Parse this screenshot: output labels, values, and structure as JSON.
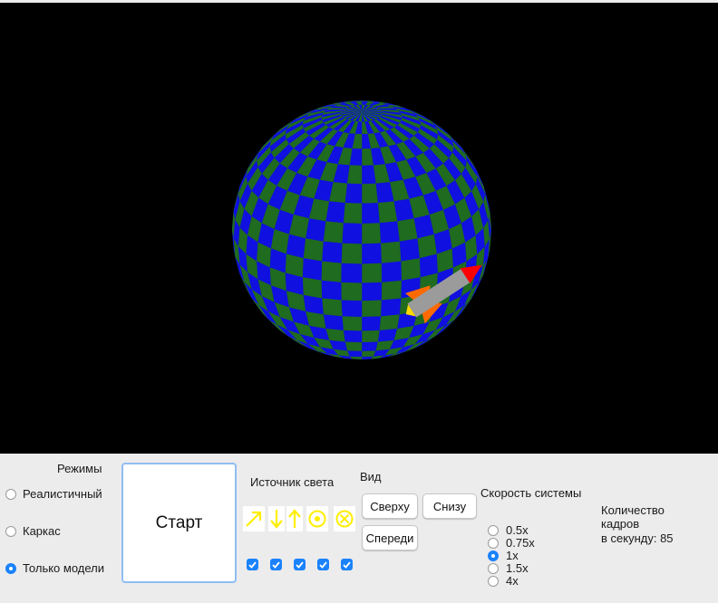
{
  "scene": {
    "background_color": "#000000",
    "planet_colors": [
      "#1f6b1f",
      "#1010e0"
    ],
    "rocket_body_color": "#9b9b9b",
    "rocket_nose_color": "#ff0000",
    "rocket_fin_color": "#ff6a00",
    "rocket_flame_color": "#ffd800"
  },
  "modes": {
    "title": "Режимы",
    "options": [
      {
        "label": "Реалистичный",
        "selected": false
      },
      {
        "label": "Каркас",
        "selected": false
      },
      {
        "label": "Только модели",
        "selected": true
      }
    ]
  },
  "start_button": {
    "label": "Старт"
  },
  "light_source": {
    "title": "Источник света",
    "icons": [
      {
        "name": "arrow-up-right-icon",
        "checked": true
      },
      {
        "name": "arrow-down-icon",
        "checked": true
      },
      {
        "name": "arrow-up-icon",
        "checked": true
      },
      {
        "name": "circle-dot-icon",
        "checked": true
      },
      {
        "name": "circle-x-icon",
        "checked": true
      }
    ],
    "icon_color": "#ffee00"
  },
  "view": {
    "title": "Вид",
    "top_label": "Сверху",
    "bottom_label": "Снизу",
    "front_label": "Спереди"
  },
  "speed": {
    "title": "Скорость системы",
    "options": [
      {
        "label": "0.5x",
        "selected": false
      },
      {
        "label": "0.75x",
        "selected": false
      },
      {
        "label": "1x",
        "selected": true
      },
      {
        "label": "1.5x",
        "selected": false
      },
      {
        "label": "4x",
        "selected": false
      }
    ]
  },
  "fps": {
    "line1": "Количество",
    "line2": "кадров",
    "line3": "в секунду: 85"
  },
  "accent_color": "#1a82fb"
}
